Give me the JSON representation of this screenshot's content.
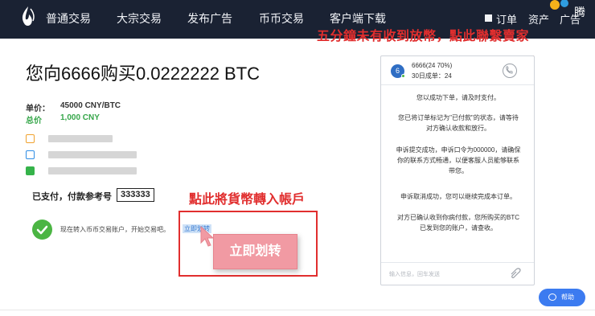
{
  "nav": {
    "items": [
      "普通交易",
      "大宗交易",
      "发布广告",
      "币币交易",
      "客户端下载"
    ],
    "right": [
      "订单",
      "资产",
      "广告"
    ]
  },
  "annotations": {
    "top_red": "五分鐘未有收到放幣，點此聯繫賣家",
    "transfer_red": "點此將貨幣轉入帳戶"
  },
  "order": {
    "title": "您向6666购买0.0222222 BTC",
    "price_label": "单价：",
    "price_value": "45000 CNY/BTC",
    "total_label": "总价",
    "total_value": "1,000 CNY",
    "ref_label": "已支付，付款参考号",
    "ref_value": "333333",
    "transfer_text": "现在转入币币交易账户，开始交易吧。",
    "transfer_link": "立即划转",
    "transfer_button": "立即划转"
  },
  "chat": {
    "avatar": "6",
    "name": "6666(24 70%)",
    "count": "30日成单：24",
    "messages": [
      "您以成功下单，请及时支付。",
      "您已将订单标记为\"已付款\"的状态，请等待对方确认收款和放行。",
      "申诉提交成功，申诉口令为000000，请确保你的联系方式畅通，以便客服人员能够联系带您。",
      "申诉取消成功，您可以继续完成本订单。",
      "对方已确认收到你病付款，您所购买的BTC已发到您的账户，请查收。"
    ],
    "input_placeholder": "输入信息，回车发送"
  },
  "help": {
    "label": "帮助"
  },
  "colors": {
    "nav_bg": "#1a2233",
    "accent_red": "#e12e2e",
    "success_green": "#4bb543",
    "button_pink": "#f19aa3",
    "help_blue": "#3c7bf0"
  },
  "icons": [
    "logo-icon",
    "square-icon",
    "corner-logo-icon",
    "alipay-icon",
    "bank-icon",
    "wechat-icon",
    "check-icon",
    "phone-icon",
    "attach-icon",
    "chat-bubble-icon"
  ]
}
